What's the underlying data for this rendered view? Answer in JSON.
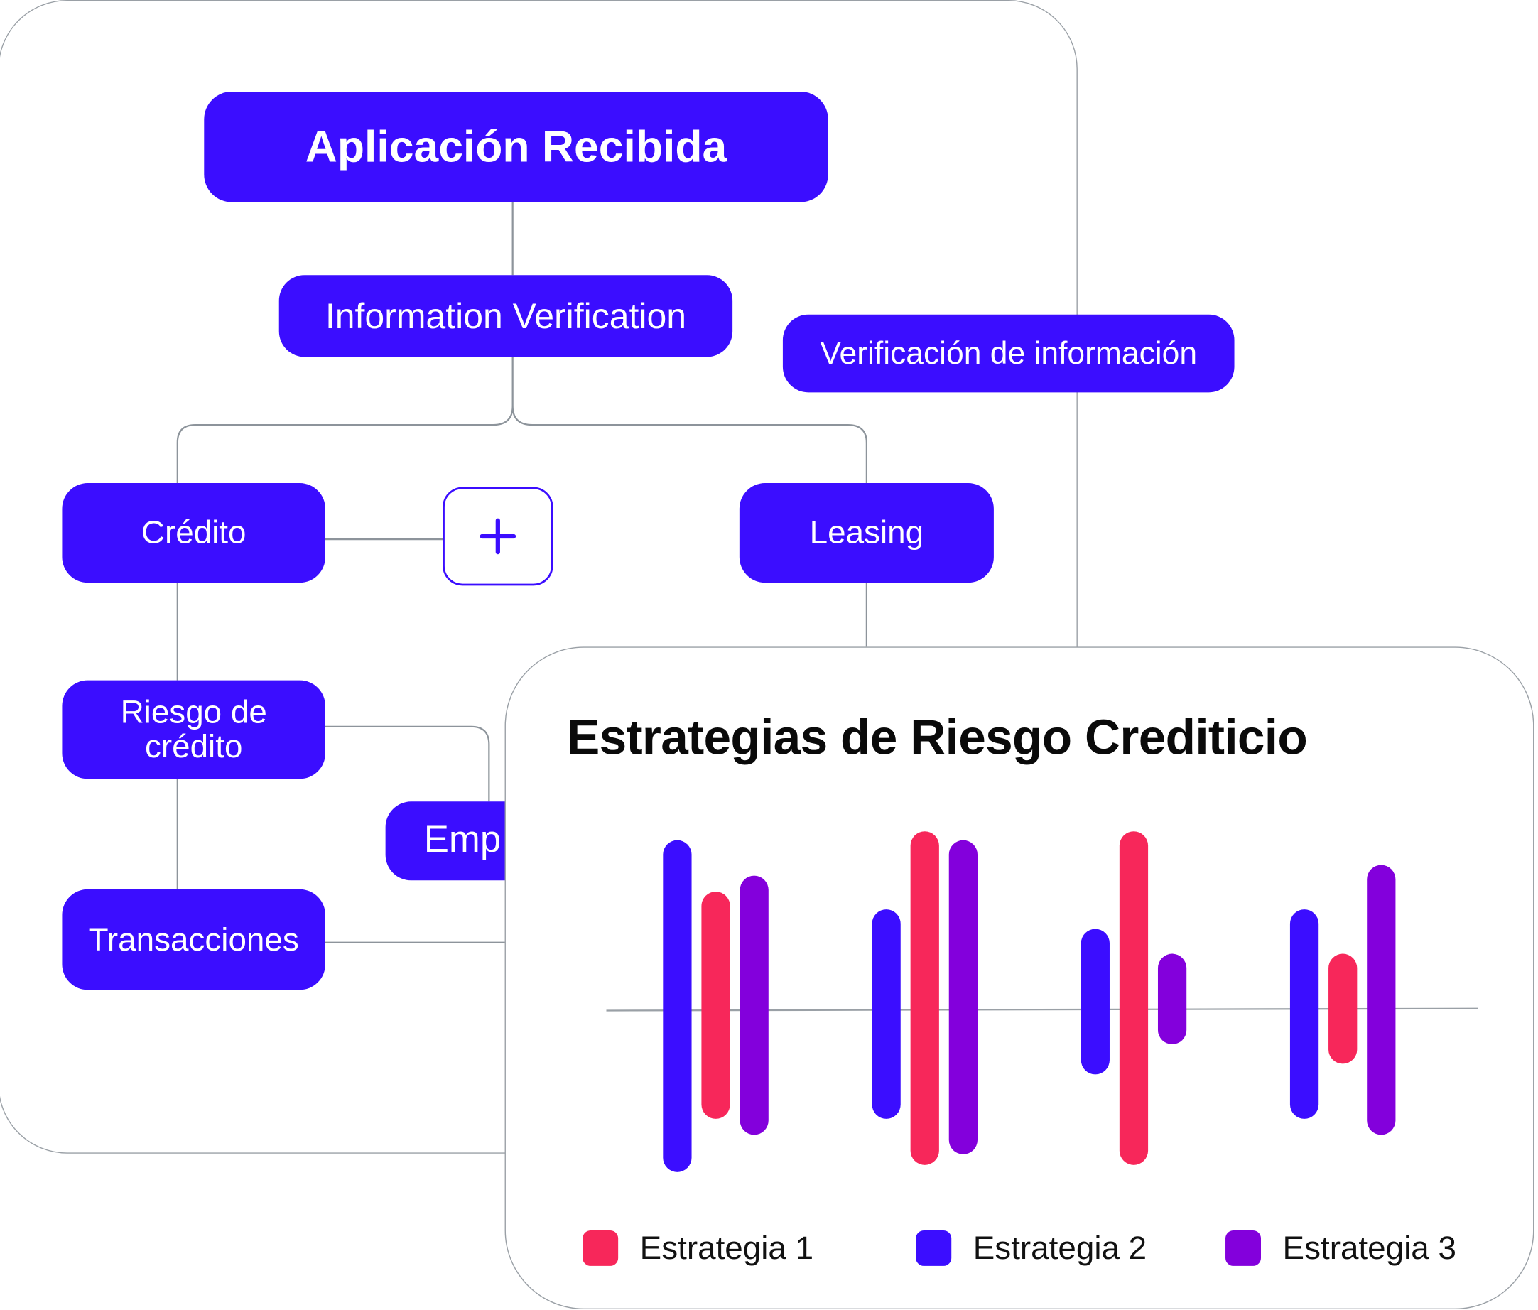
{
  "flow": {
    "root": "Aplicación Recibida",
    "verification_en": "Information Verification",
    "verification_es": "Verificación de información",
    "credit": "Crédito",
    "leasing": "Leasing",
    "credit_risk_line1": "Riesgo de",
    "credit_risk_line2": "crédito",
    "transactions": "Transacciones",
    "employment_partial": "Emp",
    "add_icon": "plus-icon"
  },
  "colors": {
    "node": "#3b0dff",
    "estrategia_1": "#f7275a",
    "estrategia_2": "#3b0dff",
    "estrategia_3": "#8300dc"
  },
  "chart_data": {
    "type": "bar",
    "subtype": "floating-range",
    "title": "Estrategias de Riesgo Crediticio",
    "xlabel": "",
    "ylabel": "",
    "ylim": [
      -10,
      10
    ],
    "grid": false,
    "baseline": 0,
    "legend_placement": "bottom",
    "group_count": 4,
    "series": [
      {
        "name": "Estrategia 2",
        "color": "#3b0dff",
        "ranges": [
          [
            -9.1,
            9.6
          ],
          [
            -6.1,
            5.7
          ],
          [
            -3.6,
            4.6
          ],
          [
            -6.1,
            5.7
          ]
        ]
      },
      {
        "name": "Estrategia 1",
        "color": "#f7275a",
        "ranges": [
          [
            -6.1,
            6.7
          ],
          [
            -8.7,
            10.1
          ],
          [
            -8.7,
            10.1
          ],
          [
            -3.0,
            3.2
          ]
        ]
      },
      {
        "name": "Estrategia 3",
        "color": "#8300dc",
        "ranges": [
          [
            -7.0,
            7.6
          ],
          [
            -8.1,
            9.6
          ],
          [
            -1.9,
            3.2
          ],
          [
            -7.0,
            8.2
          ]
        ]
      }
    ],
    "legend": [
      "Estrategia 1",
      "Estrategia 2",
      "Estrategia 3"
    ]
  }
}
